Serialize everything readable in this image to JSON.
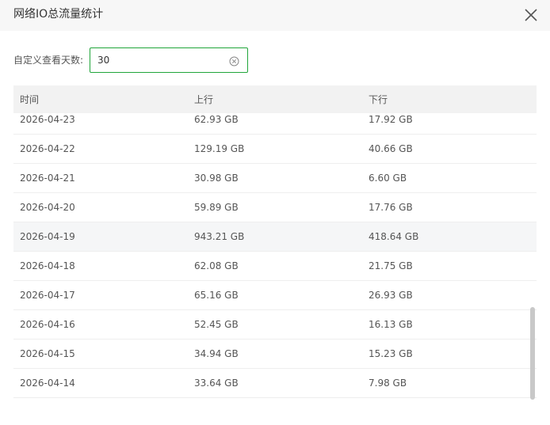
{
  "dialog": {
    "title": "网络IO总流量统计",
    "close_icon": "close-icon"
  },
  "filter": {
    "label": "自定义查看天数:",
    "value": "30",
    "clear_icon": "clear-circle-icon"
  },
  "table": {
    "columns": [
      "时间",
      "上行",
      "下行"
    ],
    "rows": [
      {
        "date": "2026-04-23",
        "up": "62.93 GB",
        "down": "17.92 GB"
      },
      {
        "date": "2026-04-22",
        "up": "129.19 GB",
        "down": "40.66 GB"
      },
      {
        "date": "2026-04-21",
        "up": "30.98 GB",
        "down": "6.60 GB"
      },
      {
        "date": "2026-04-20",
        "up": "59.89 GB",
        "down": "17.76 GB"
      },
      {
        "date": "2026-04-19",
        "up": "943.21 GB",
        "down": "418.64 GB"
      },
      {
        "date": "2026-04-18",
        "up": "62.08 GB",
        "down": "21.75 GB"
      },
      {
        "date": "2026-04-17",
        "up": "65.16 GB",
        "down": "26.93 GB"
      },
      {
        "date": "2026-04-16",
        "up": "52.45 GB",
        "down": "16.13 GB"
      },
      {
        "date": "2026-04-15",
        "up": "34.94 GB",
        "down": "15.23 GB"
      },
      {
        "date": "2026-04-14",
        "up": "33.64 GB",
        "down": "7.98 GB"
      }
    ]
  },
  "colors": {
    "accent": "#20a53a",
    "header_bg": "#f7f7f7",
    "table_header_bg": "#f2f2f2",
    "row_hover_bg": "#f5f6f7"
  }
}
